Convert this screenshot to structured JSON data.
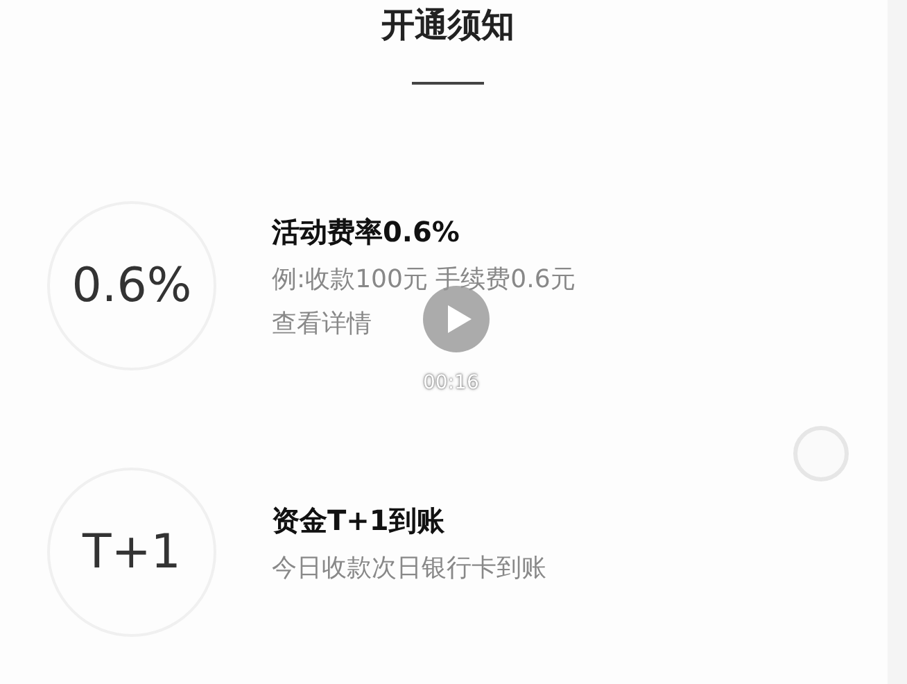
{
  "title": "开通须知",
  "items": [
    {
      "badge": "0.6%",
      "title": "活动费率0.6%",
      "lines": [
        "例:收款100元 手续费0.6元",
        "查看详情"
      ]
    },
    {
      "badge": "T+1",
      "title": "资金T+1到账",
      "lines": [
        "今日收款次日银行卡到账"
      ]
    }
  ],
  "video": {
    "time": "00:16"
  }
}
